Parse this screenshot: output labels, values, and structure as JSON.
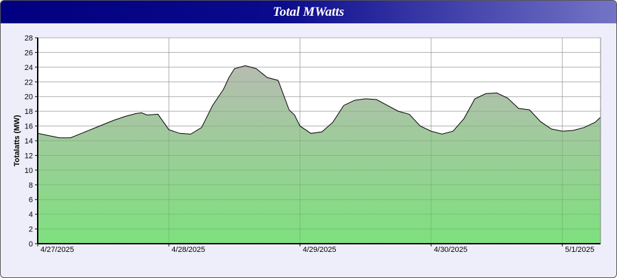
{
  "chart_data": {
    "type": "area",
    "title": "Total MWatts",
    "ylabel": "Totalatts (MW)",
    "xlabel": "",
    "ylim": [
      0,
      28
    ],
    "yticks": [
      0,
      2,
      4,
      6,
      8,
      10,
      12,
      14,
      16,
      18,
      20,
      22,
      24,
      26,
      28
    ],
    "xlim": [
      "2025-04-27T00:00",
      "2025-05-01T07:00"
    ],
    "x_tick_labels": [
      "4/27/2025",
      "4/28/2025",
      "4/29/2025",
      "4/30/2025",
      "5/1/2025"
    ],
    "grid": true,
    "fill_colors": {
      "top": "#b6bcb0",
      "bottom": "#7ee07e"
    },
    "line_color": "#000000",
    "series": [
      {
        "x": [
          "2025-04-27T00:00",
          "2025-04-27T02:00",
          "2025-04-27T04:00",
          "2025-04-27T06:00",
          "2025-04-27T08:00",
          "2025-04-27T10:00",
          "2025-04-27T12:00",
          "2025-04-27T14:00",
          "2025-04-27T16:00",
          "2025-04-27T18:00",
          "2025-04-27T19:00",
          "2025-04-27T20:00",
          "2025-04-27T22:00",
          "2025-04-28T00:00",
          "2025-04-28T02:00",
          "2025-04-28T04:00",
          "2025-04-28T06:00",
          "2025-04-28T08:00",
          "2025-04-28T10:00",
          "2025-04-28T11:00",
          "2025-04-28T12:00",
          "2025-04-28T14:00",
          "2025-04-28T16:00",
          "2025-04-28T18:00",
          "2025-04-28T20:00",
          "2025-04-28T22:00",
          "2025-04-28T23:00",
          "2025-04-29T00:00",
          "2025-04-29T02:00",
          "2025-04-29T04:00",
          "2025-04-29T06:00",
          "2025-04-29T08:00",
          "2025-04-29T10:00",
          "2025-04-29T12:00",
          "2025-04-29T14:00",
          "2025-04-29T16:00",
          "2025-04-29T18:00",
          "2025-04-29T20:00",
          "2025-04-29T22:00",
          "2025-04-30T00:00",
          "2025-04-30T02:00",
          "2025-04-30T04:00",
          "2025-04-30T06:00",
          "2025-04-30T08:00",
          "2025-04-30T10:00",
          "2025-04-30T12:00",
          "2025-04-30T14:00",
          "2025-04-30T16:00",
          "2025-04-30T18:00",
          "2025-04-30T20:00",
          "2025-04-30T22:00",
          "2025-05-01T00:00",
          "2025-05-01T02:00",
          "2025-05-01T04:00",
          "2025-05-01T06:00",
          "2025-05-01T07:00"
        ],
        "y": [
          15.0,
          14.7,
          14.4,
          14.4,
          15.0,
          15.6,
          16.2,
          16.8,
          17.3,
          17.7,
          17.8,
          17.5,
          17.6,
          15.5,
          15.0,
          14.9,
          15.8,
          18.8,
          21.0,
          22.6,
          23.8,
          24.2,
          23.8,
          22.6,
          22.2,
          18.2,
          17.5,
          16.0,
          15.0,
          15.2,
          16.5,
          18.8,
          19.5,
          19.7,
          19.6,
          18.8,
          18.0,
          17.6,
          16.0,
          15.3,
          14.9,
          15.3,
          17.0,
          19.7,
          20.4,
          20.5,
          19.8,
          18.4,
          18.2,
          16.6,
          15.6,
          15.3,
          15.4,
          15.8,
          16.5,
          17.2
        ]
      }
    ]
  }
}
